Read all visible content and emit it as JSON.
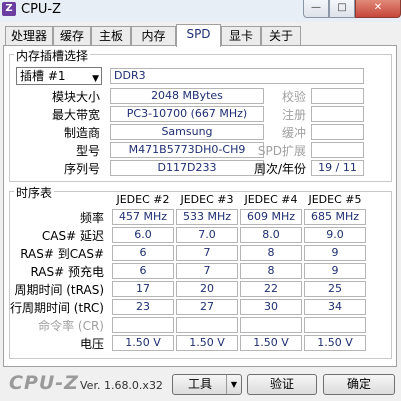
{
  "window": {
    "title": "CPU-Z",
    "icon_label": "Z",
    "controls": [
      "—",
      "□",
      "✕"
    ]
  },
  "tabs": [
    {
      "label": "处理器"
    },
    {
      "label": "缓存"
    },
    {
      "label": "主板"
    },
    {
      "label": "内存"
    },
    {
      "label": "SPD",
      "active": true
    },
    {
      "label": "显卡"
    },
    {
      "label": "关于"
    }
  ],
  "slot_group": {
    "title": "内存插槽选择",
    "slot_select": "插槽 #1",
    "memory_type": "DDR3",
    "rows": [
      {
        "label": "模块大小",
        "value": "2048 MBytes",
        "right_label": "校验",
        "right_value": ""
      },
      {
        "label": "最大带宽",
        "value": "PC3-10700 (667 MHz)",
        "right_label": "注册",
        "right_value": ""
      },
      {
        "label": "制造商",
        "value": "Samsung",
        "right_label": "缓冲",
        "right_value": ""
      },
      {
        "label": "型号",
        "value": "M471B5773DH0-CH9",
        "right_label": "SPD扩展",
        "right_value": ""
      },
      {
        "label": "序列号",
        "value": "D117D233",
        "right_label": "周次/年份",
        "right_value": "19 / 11"
      }
    ]
  },
  "timing_group": {
    "title": "时序表",
    "columns": [
      "JEDEC #2",
      "JEDEC #3",
      "JEDEC #4",
      "JEDEC #5"
    ],
    "rows": [
      {
        "label": "频率",
        "values": [
          "457 MHz",
          "533 MHz",
          "609 MHz",
          "685 MHz"
        ]
      },
      {
        "label": "CAS# 延迟",
        "values": [
          "6.0",
          "7.0",
          "8.0",
          "9.0"
        ]
      },
      {
        "label": "RAS# 到CAS#",
        "values": [
          "6",
          "7",
          "8",
          "9"
        ]
      },
      {
        "label": "RAS# 预充电",
        "values": [
          "6",
          "7",
          "8",
          "9"
        ]
      },
      {
        "label": "周期时间 (tRAS)",
        "values": [
          "17",
          "20",
          "22",
          "25"
        ]
      },
      {
        "label": "行周期时间 (tRC)",
        "values": [
          "23",
          "27",
          "30",
          "34"
        ]
      },
      {
        "label": "命令率 (CR)",
        "values": [
          "",
          "",
          "",
          ""
        ]
      },
      {
        "label": "电压",
        "values": [
          "1.50 V",
          "1.50 V",
          "1.50 V",
          "1.50 V"
        ]
      }
    ]
  },
  "footer": {
    "brand": "CPU-Z",
    "version": "Ver. 1.68.0.x32",
    "tools_label": "工具",
    "validate_label": "验证",
    "ok_label": "确定"
  }
}
